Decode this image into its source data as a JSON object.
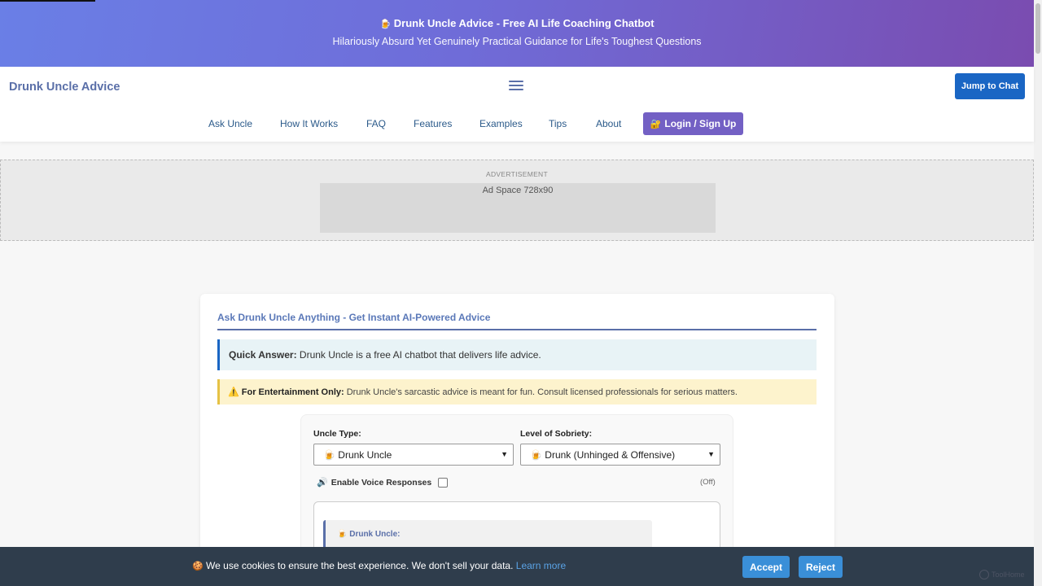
{
  "banner": {
    "emoji": "🍺",
    "title": "Drunk Uncle Advice - Free AI Life Coaching Chatbot",
    "subtitle": "Hilariously Absurd Yet Genuinely Practical Guidance for Life's Toughest Questions"
  },
  "nav": {
    "brand": "Drunk Uncle Advice",
    "jump_label": "Jump to Chat",
    "links": [
      "Ask Uncle",
      "How It Works",
      "FAQ",
      "Features",
      "Examples",
      "Tips",
      "About"
    ],
    "login_emoji": "🔐",
    "login_label": "Login / Sign Up"
  },
  "ad": {
    "label": "ADVERTISEMENT",
    "placeholder": "Ad Space 728x90"
  },
  "card": {
    "title": "Ask Drunk Uncle Anything - Get Instant AI-Powered Advice",
    "quick_label": "Quick Answer:",
    "quick_text": " Drunk Uncle is a free AI chatbot that delivers life advice.",
    "warn_icon": "⚠️",
    "warn_label": "For Entertainment Only:",
    "warn_text": " Drunk Uncle's sarcastic advice is meant for fun. Consult licensed professionals for serious matters."
  },
  "panel": {
    "uncle_type_label": "Uncle Type:",
    "uncle_type_value": "🍺 Drunk Uncle",
    "sobriety_label": "Level of Sobriety:",
    "sobriety_value": "🍺 Drunk (Unhinged & Offensive)",
    "voice_icon": "🔊",
    "voice_label": "Enable Voice Responses",
    "voice_state": "(Off)",
    "message_name": "🍺 Drunk Uncle:"
  },
  "cookie": {
    "emoji": "🍪",
    "text": "We use cookies to ensure the best experience. We don't sell your data. ",
    "learn_more": "Learn more",
    "accept": "Accept",
    "reject": "Reject"
  },
  "watermark": "ToolHome",
  "colors": {
    "banner_start": "#6a7fe6",
    "banner_end": "#7a4cb0",
    "primary_blue": "#1a66c4",
    "login_purple": "#7360c4",
    "cookie_bg": "#2f3d4c"
  }
}
